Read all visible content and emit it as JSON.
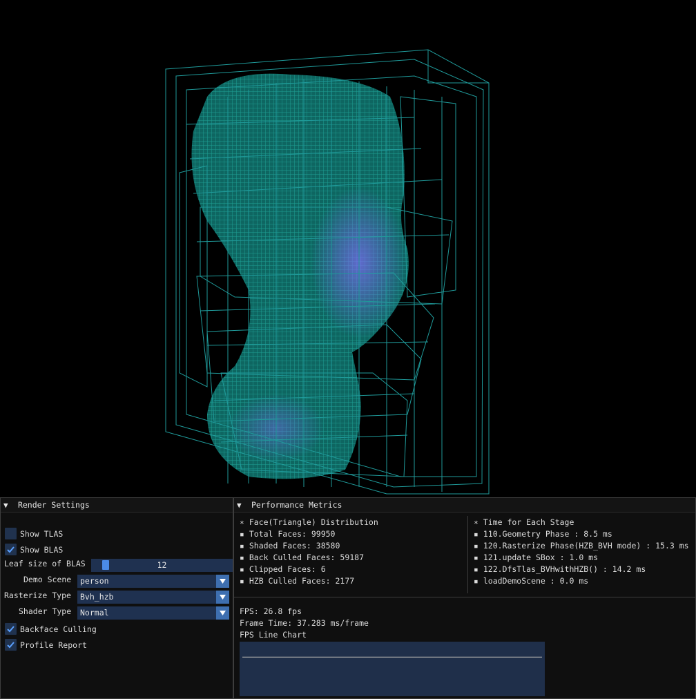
{
  "render_settings": {
    "title": "Render Settings",
    "show_tlas": {
      "label": "Show TLAS",
      "checked": false
    },
    "show_blas": {
      "label": "Show BLAS",
      "checked": true
    },
    "leaf_size": {
      "label": "Leaf size of BLAS",
      "value": "12"
    },
    "demo_scene": {
      "label": "Demo Scene",
      "value": "person"
    },
    "rasterize_type": {
      "label": "Rasterize Type",
      "value": "Bvh_hzb"
    },
    "shader_type": {
      "label": "Shader Type",
      "value": "Normal"
    },
    "backface_culling": {
      "label": "Backface Culling",
      "checked": true
    },
    "profile_report": {
      "label": "Profile Report",
      "checked": true
    }
  },
  "performance": {
    "title": "Performance Metrics",
    "faces": {
      "header": "∗ Face(Triangle) Distribution",
      "items": [
        "▪ Total Faces: 99950",
        "▪ Shaded Faces: 38580",
        "▪ Back Culled Faces: 59187",
        "▪ Clipped Faces: 6",
        "▪ HZB Culled Faces: 2177"
      ]
    },
    "stages": {
      "header": "∗ Time for Each Stage",
      "items": [
        "▪ 110.Geometry Phase : 8.5 ms",
        "▪ 120.Rasterize Phase(HZB_BVH mode) : 15.3 ms",
        "▪ 121.update SBox : 1.0 ms",
        "▪ 122.DfsTlas_BVHwithHZB() : 14.2 ms",
        "▪ loadDemoScene : 0.0 ms"
      ]
    },
    "fps": "FPS: 26.8 fps",
    "frame_time": "Frame Time: 37.283 ms/frame",
    "chart_label": "FPS Line Chart"
  },
  "chart_data": {
    "type": "line",
    "title": "FPS Line Chart",
    "series": [
      {
        "values": [
          26.8,
          26.8,
          26.8,
          26.8,
          26.8,
          26.8,
          26.8,
          26.8,
          26.8,
          26.8
        ]
      }
    ]
  },
  "colors": {
    "bvh_wire": "#1f9a9a",
    "mesh": "#188a80",
    "mesh_shade": "#7a6cf0",
    "accent": "#4b8be6",
    "field_bg": "#1f3150"
  }
}
